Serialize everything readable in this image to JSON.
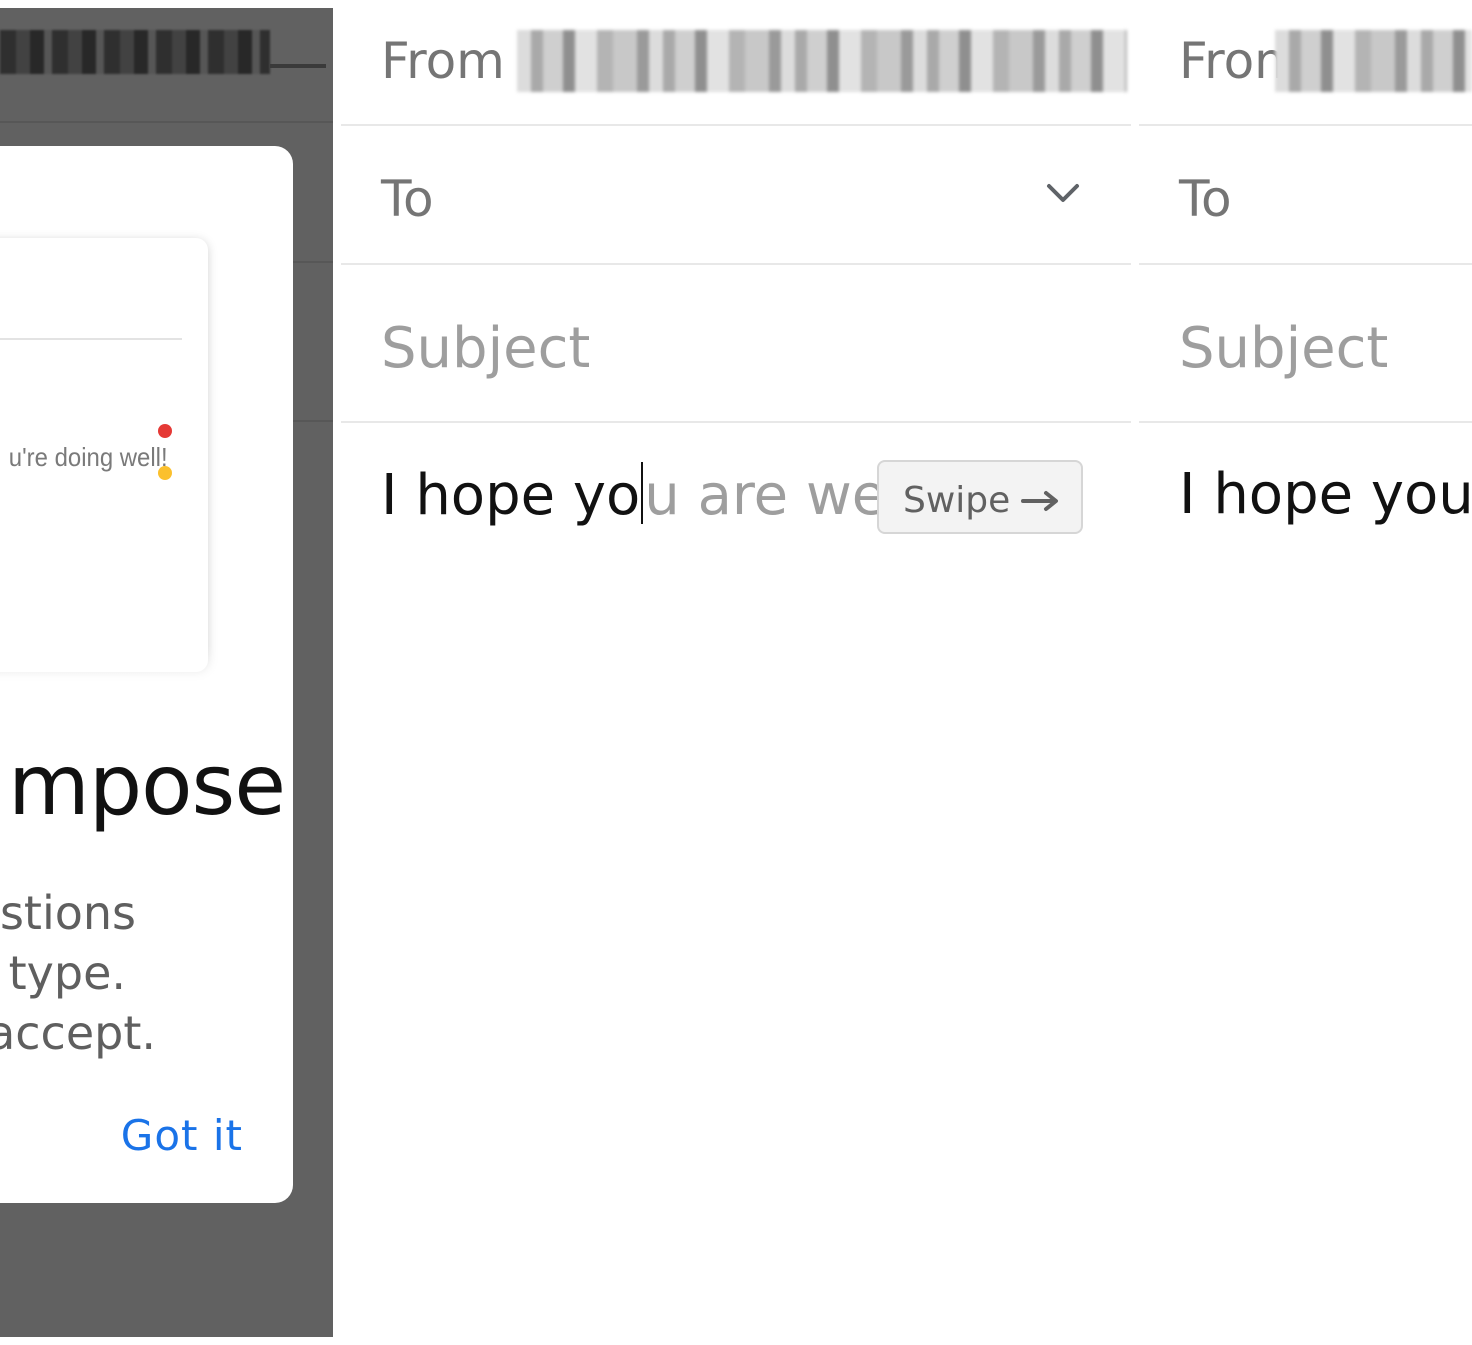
{
  "onboarding_dialog": {
    "illustration_text": "u're doing well!",
    "title": "mpose",
    "body_lines": [
      "estions",
      "u type.",
      "accept."
    ],
    "button_label": "Got it"
  },
  "compose_left": {
    "from_label": "From",
    "to_label": "To",
    "subject_placeholder": "Subject",
    "body_typed_before_caret": "I hope yo",
    "body_typed_after_caret": "",
    "body_suggestion": "u are well",
    "swipe_chip_label": "Swipe",
    "icons": {
      "to_expand": "chevron-down-icon",
      "swipe": "arrow-right-icon"
    }
  },
  "compose_right": {
    "from_label": "From",
    "to_label": "To",
    "subject_placeholder": "Subject",
    "body_text": "I hope you a"
  },
  "colors": {
    "accent_blue": "#1a73e8",
    "dim_overlay": "#616161",
    "suggestion_gray": "#9e9e9e",
    "dot_red": "#e53935",
    "dot_yellow": "#fbc02d"
  }
}
